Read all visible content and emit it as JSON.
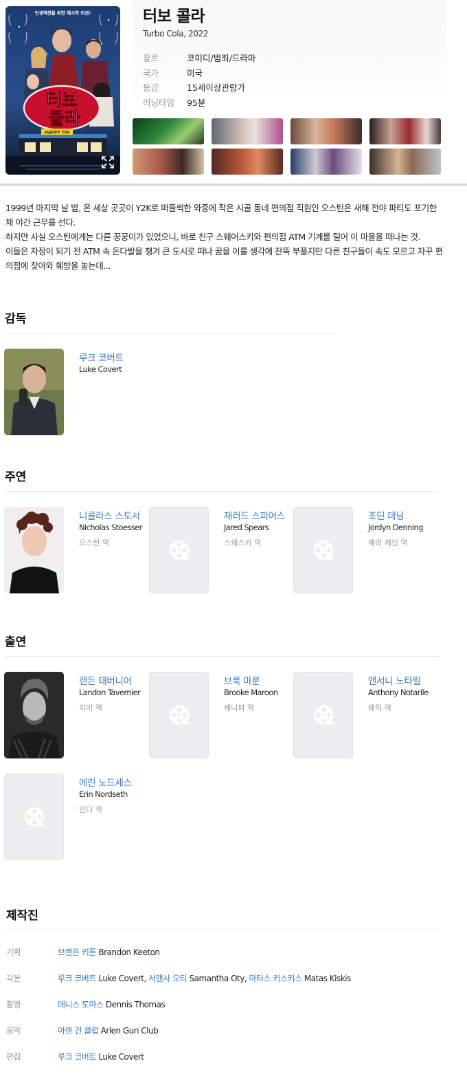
{
  "movie": {
    "title": "터보 콜라",
    "subtitle": "Turbo Cola, 2022",
    "info": [
      {
        "label": "장르",
        "value": "코미디/범죄/드라마"
      },
      {
        "label": "국가",
        "value": "미국"
      },
      {
        "label": "등급",
        "value": "15세이상관람가"
      },
      {
        "label": "러닝타임",
        "value": "95분"
      }
    ],
    "poster": {
      "top_text": "인생역전을 위한 애시작 미션!",
      "title_art": "터보 콜라"
    }
  },
  "synopsis": [
    "1999년 마지막 날 밤, 온 세상 곳곳이 Y2K로 떠들썩한 와중에 작은 시골 동네 편의점 직원인 오스틴은 새해 전야 파티도 포기한 채 야간 근무를 선다.",
    "하지만 사실 오스틴에게는 다른 꿍꿍이가 있었으니, 바로 친구 스웨어스키와 편의점 ATM 기계를 털어 이 마을을 떠나는 것.",
    "이들은 자정이 되기 전 ATM 속 돈다발을 챙겨 큰 도시로 떠나 꿈을 이룰 생각에 잔뜩 부풀지만 다른 친구들이 속도 모르고 자꾸 편의점에 찾아와 훼방을 놓는데..."
  ],
  "directors": {
    "title": "감독",
    "people": [
      {
        "kr": "루크 코버트",
        "en": "Luke Covert"
      }
    ]
  },
  "lead_cast": {
    "title": "주연",
    "people": [
      {
        "kr": "니콜라스 스토서",
        "en": "Nicholas Stoesser",
        "role": "오스틴 역"
      },
      {
        "kr": "재러드 스피어스",
        "en": "Jared Spears",
        "role": "스웨스키 역"
      },
      {
        "kr": "조딘 데닝",
        "en": "Jordyn Denning",
        "role": "메리 제인 역"
      }
    ]
  },
  "supporting_cast": {
    "title": "출연",
    "people": [
      {
        "kr": "랜든 태버니어",
        "en": "Landon Tavernier",
        "role": "지미 역"
      },
      {
        "kr": "브룩 마룬",
        "en": "Brooke Maroon",
        "role": "제니퍼 역"
      },
      {
        "kr": "앤서니 노타릴",
        "en": "Anthony Notarile",
        "role": "에릭 역"
      },
      {
        "kr": "에린 노드세스",
        "en": "Erin Nordseth",
        "role": "민디 역"
      }
    ]
  },
  "crew": {
    "title": "제작진",
    "rows": [
      {
        "label": "기획",
        "people": [
          {
            "kr": "브랜든 키튼",
            "en": "Brandon Keeton"
          }
        ]
      },
      {
        "label": "각본",
        "people": [
          {
            "kr": "루크 코버트",
            "en": "Luke Covert,"
          },
          {
            "kr": "서맨사 오티",
            "en": "Samantha Oty,"
          },
          {
            "kr": "마타스 키스키스",
            "en": "Matas Kiskis"
          }
        ]
      },
      {
        "label": "촬영",
        "people": [
          {
            "kr": "데니스 토마스",
            "en": "Dennis Thomas"
          }
        ]
      },
      {
        "label": "음악",
        "people": [
          {
            "kr": "아렌 건 클럽",
            "en": "Arlen Gun Club"
          }
        ]
      },
      {
        "label": "편집",
        "people": [
          {
            "kr": "루크 코버트",
            "en": "Luke Covert"
          }
        ]
      }
    ]
  },
  "colors": {
    "link": "#3e7ac2",
    "label": "#999999",
    "divider": "#d6d6d6"
  }
}
